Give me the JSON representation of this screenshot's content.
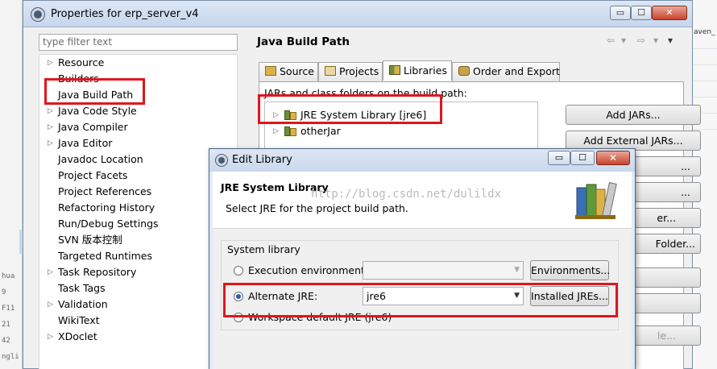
{
  "background": {
    "left_fragments": [
      "hua",
      "9",
      "F11",
      "21",
      "42",
      "ngli"
    ],
    "right_fragment": "aven_"
  },
  "props_window": {
    "title": "Properties for erp_server_v4",
    "buttons": {
      "minimize": "▭",
      "maximize": "☐",
      "close": "✕"
    },
    "filter_placeholder": "type filter text",
    "tree": [
      {
        "label": "Resource",
        "expandable": true
      },
      {
        "label": "Builders",
        "expandable": false
      },
      {
        "label": "Java Build Path",
        "expandable": false
      },
      {
        "label": "Java Code Style",
        "expandable": true
      },
      {
        "label": "Java Compiler",
        "expandable": true
      },
      {
        "label": "Java Editor",
        "expandable": true
      },
      {
        "label": "Javadoc Location",
        "expandable": false
      },
      {
        "label": "Project Facets",
        "expandable": false
      },
      {
        "label": "Project References",
        "expandable": false
      },
      {
        "label": "Refactoring History",
        "expandable": false
      },
      {
        "label": "Run/Debug Settings",
        "expandable": false
      },
      {
        "label": "SVN 版本控制",
        "expandable": false
      },
      {
        "label": "Targeted Runtimes",
        "expandable": false
      },
      {
        "label": "Task Repository",
        "expandable": true
      },
      {
        "label": "Task Tags",
        "expandable": false
      },
      {
        "label": "Validation",
        "expandable": true
      },
      {
        "label": "WikiText",
        "expandable": false
      },
      {
        "label": "XDoclet",
        "expandable": true
      }
    ],
    "page_title": "Java Build Path",
    "nav_icons": [
      "⇦",
      "▾",
      "⇨",
      "▾",
      "▾"
    ],
    "tabs": [
      "Source",
      "Projects",
      "Libraries",
      "Order and Export"
    ],
    "active_tab": "Libraries",
    "jars_label": "JARs and class folders on the build path:",
    "jar_items": [
      "JRE System Library [jre6]",
      "otherJar"
    ],
    "side_buttons": [
      {
        "label": "Add JARs...",
        "dim": false
      },
      {
        "label": "Add External JARs...",
        "dim": false
      },
      {
        "label": "...",
        "dim": false
      },
      {
        "label": "...",
        "dim": false
      },
      {
        "label": "er...",
        "dim": false
      },
      {
        "label": "Folder...",
        "dim": false
      },
      {
        "label": "",
        "dim": false
      },
      {
        "label": "",
        "dim": false
      },
      {
        "label": "le...",
        "dim": true
      }
    ]
  },
  "edit_dialog": {
    "title": "Edit Library",
    "buttons": {
      "minimize": "▭",
      "maximize": "☐",
      "close": "✕"
    },
    "header_title": "JRE System Library",
    "header_desc": "Select JRE for the project build path.",
    "watermark": "http://blog.csdn.net/dulildx",
    "group_title": "System library",
    "options": [
      {
        "label": "Execution environment:",
        "selected": false
      },
      {
        "label": "Alternate JRE:",
        "selected": true
      },
      {
        "label": "Workspace default JRE (jre6)",
        "selected": false
      }
    ],
    "exec_env_value": "",
    "alt_jre_value": "jre6",
    "environments_button": "Environments...",
    "installed_jres_button": "Installed JREs..."
  },
  "colors": {
    "highlight_box": "#e0161d",
    "radio_selected": "#2d5da8"
  }
}
